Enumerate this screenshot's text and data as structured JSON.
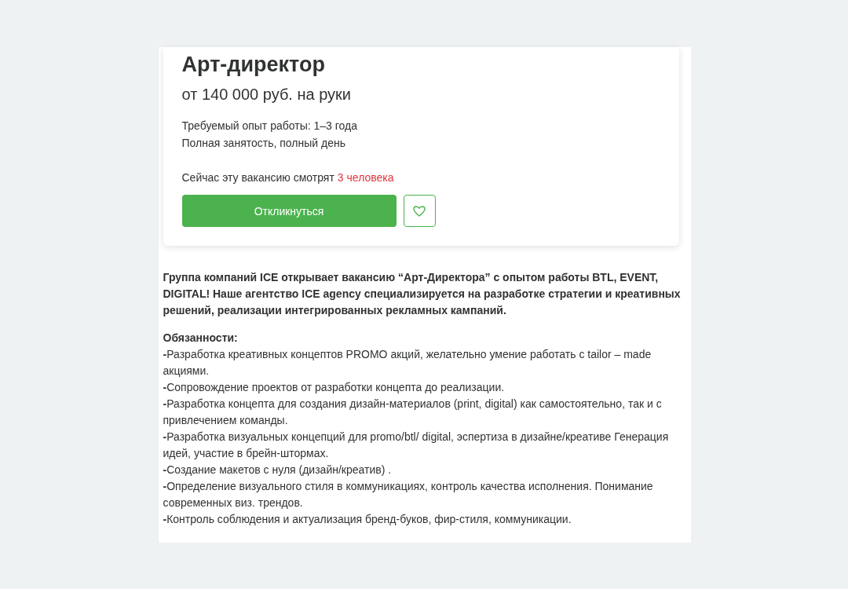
{
  "vacancy": {
    "title": "Арт-директор",
    "salary": "от 140 000 руб. на руки",
    "details": [
      "Требуемый опыт работы: 1–3 года",
      "Полная занятость, полный день"
    ],
    "viewers": {
      "text": "Сейчас эту вакансию смотрят",
      "count": "3 человека"
    },
    "respond_button": "Откликнуться",
    "favorite": {
      "on": false
    }
  },
  "description": {
    "intro": "Группа компаний ICE открывает вакансию “Арт-Директора” с опытом работы BTL, EVENT, DIGITAL! Наше агентство ICE agency специализируется на разработке стратегии и креативных решений, реализации интегрированных рекламных кампаний.",
    "sections": [
      {
        "heading": "Обязанности:",
        "items": [
          "**-**Разработка креативных концептов PROMO акций, желательно умение работать с tailor – made акциями.",
          "**-**Сопровождение проектов от разработки концепта до реализации.",
          "**-**Разработка концепта для создания дизайн-материалов (print, digital) как самостоятельно, так и с привлечением команды.",
          "**-**Разработка визуальных концепций для promo/btl/ digital, эспертиза в дизайне/креативе Генерация идей, участие в брейн-штормах.",
          "**-**Создание макетов с нуля (дизайн/креатив) .",
          "**-**Определение визуального стиля в коммуникациях, контроль качества исполнения. Понимание современных виз. трендов.",
          "**-**Контроль соблюдения и актуализация бренд-буков, фир-стиля, коммуникации."
        ]
      }
    ]
  }
}
